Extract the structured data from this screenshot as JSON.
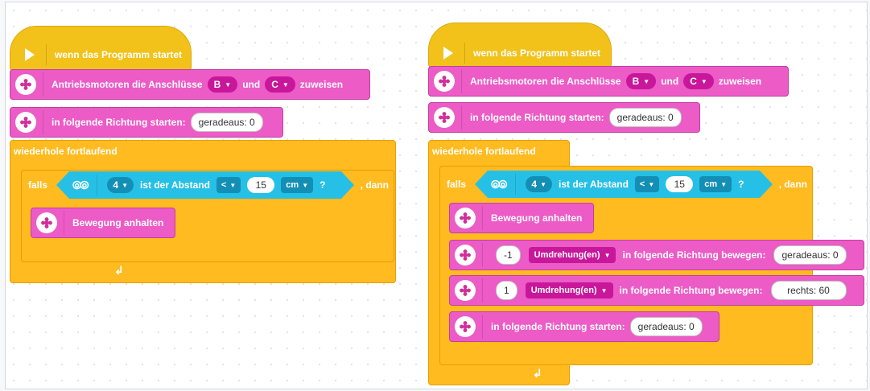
{
  "colors": {
    "hat": "#f2c21a",
    "motor_block": "#ec5bc6",
    "control_block": "#ffbb1f",
    "sensor_block": "#26c0e6"
  },
  "programs": [
    {
      "start": "wenn das Programm startet",
      "assign": {
        "text": "Antriebsmotoren die Anschlüsse",
        "port1": "B",
        "and": "und",
        "port2": "C",
        "end": "zuweisen"
      },
      "start_move": {
        "text": "in folgende Richtung starten:",
        "value": "geradeaus: 0"
      },
      "loop": "wiederhole fortlaufend",
      "if": {
        "label": "falls",
        "port": "4",
        "cond": "ist der Abstand",
        "op": "<",
        "value": "15",
        "unit": "cm",
        "q": "?",
        "then": ", dann"
      },
      "stop": "Bewegung anhalten",
      "loop_icon": "loop-arrow-icon"
    },
    {
      "start": "wenn das Programm startet",
      "assign": {
        "text": "Antriebsmotoren die Anschlüsse",
        "port1": "B",
        "and": "und",
        "port2": "C",
        "end": "zuweisen"
      },
      "start_move": {
        "text": "in folgende Richtung starten:",
        "value": "geradeaus: 0"
      },
      "loop": "wiederhole fortlaufend",
      "if": {
        "label": "falls",
        "port": "4",
        "cond": "ist der Abstand",
        "op": "<",
        "value": "15",
        "unit": "cm",
        "q": "?",
        "then": ", dann"
      },
      "stop": "Bewegung anhalten",
      "move1": {
        "amount": "-1",
        "unit": "Umdrehung(en)",
        "text": "in folgende Richtung bewegen:",
        "value": "geradeaus: 0"
      },
      "move2": {
        "amount": "1",
        "unit": "Umdrehung(en)",
        "text": "in folgende Richtung bewegen:",
        "value": "rechts: 60"
      },
      "start_move2": {
        "text": "in folgende Richtung starten:",
        "value": "geradeaus: 0"
      },
      "loop_icon": "loop-arrow-icon"
    }
  ]
}
